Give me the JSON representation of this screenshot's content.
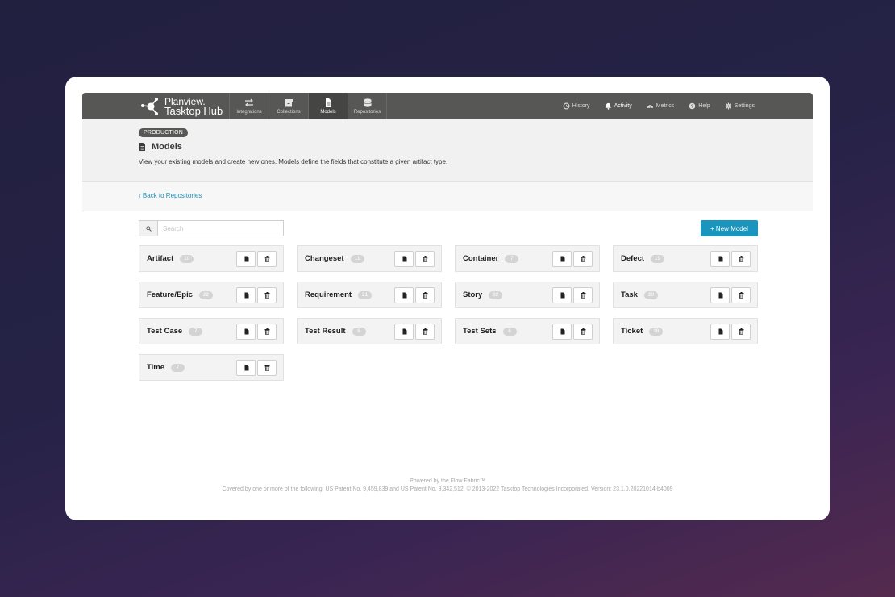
{
  "brand": {
    "line1": "Planview.",
    "line2": "Tasktop Hub"
  },
  "nav": {
    "tabs": [
      {
        "label": "Integrations",
        "icon": "arrows-exchange-icon"
      },
      {
        "label": "Collections",
        "icon": "archive-box-icon"
      },
      {
        "label": "Models",
        "icon": "document-icon",
        "active": true
      },
      {
        "label": "Repositories",
        "icon": "database-icon"
      }
    ],
    "links": [
      {
        "label": "History",
        "icon": "history-icon"
      },
      {
        "label": "Activity",
        "icon": "bell-icon",
        "active": true
      },
      {
        "label": "Metrics",
        "icon": "gauge-icon"
      },
      {
        "label": "Help",
        "icon": "question-icon"
      },
      {
        "label": "Settings",
        "icon": "gear-icon"
      }
    ]
  },
  "header": {
    "environment": "PRODUCTION",
    "title": "Models",
    "description": "View your existing models and create new ones. Models define the fields that constitute a given artifact type."
  },
  "back_link": "Back to Repositories",
  "search": {
    "placeholder": "Search",
    "value": ""
  },
  "new_model_label": "+ New Model",
  "models": [
    {
      "name": "Artifact",
      "count": "10"
    },
    {
      "name": "Changeset",
      "count": "11"
    },
    {
      "name": "Container",
      "count": "7"
    },
    {
      "name": "Defect",
      "count": "19"
    },
    {
      "name": "Feature/Epic",
      "count": "22"
    },
    {
      "name": "Requirement",
      "count": "21"
    },
    {
      "name": "Story",
      "count": "32"
    },
    {
      "name": "Task",
      "count": "20"
    },
    {
      "name": "Test Case",
      "count": "7"
    },
    {
      "name": "Test Result",
      "count": "6"
    },
    {
      "name": "Test Sets",
      "count": "6"
    },
    {
      "name": "Ticket",
      "count": "18"
    },
    {
      "name": "Time",
      "count": "7"
    }
  ],
  "footer": {
    "line1": "Powered by the Flow Fabric™",
    "line2": "Covered by one or more of the following: US Patent No. 9,459,839 and US Patent No. 9,342,512. © 2013-2022 Tasktop Technologies Incorporated. Version: 23.1.0.20221014-b4009"
  },
  "colors": {
    "nav_bg": "#575755",
    "accent": "#1a96be",
    "link": "#1a8fb5"
  }
}
